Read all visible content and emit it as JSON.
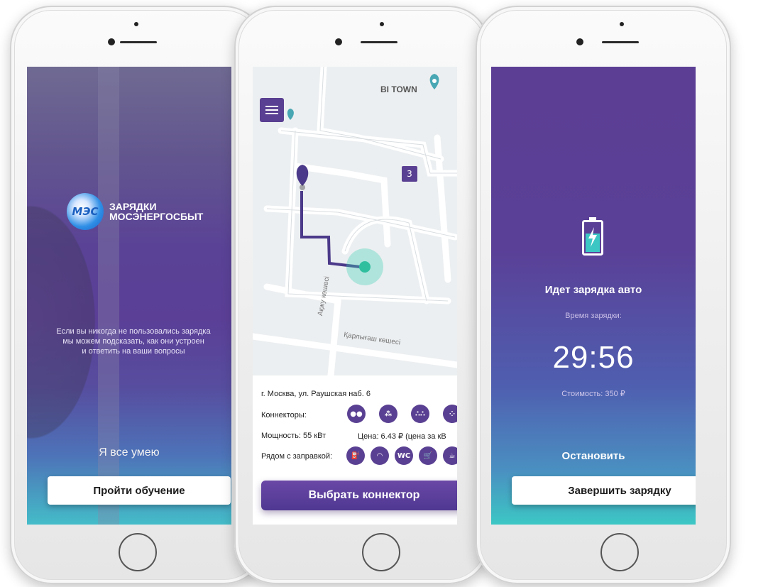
{
  "screen1": {
    "brand_line1": "ЗАРЯДКИ",
    "brand_line2": "МОСЭНЕРГОСБЫТ",
    "logo_text": "МЭС",
    "intro_line1": "Если вы никогда не пользовались зарядка",
    "intro_line2": "мы можем подсказать, как они устроен",
    "intro_line3": "и ответить на ваши вопросы",
    "skip_label": "Я все умею",
    "tutorial_button": "Пройти обучение"
  },
  "screen2": {
    "place_label": "BI TOWN",
    "cluster_count": "3",
    "street_1": "Ақжу көшесі",
    "street_2": "Қарлығаш көшесі",
    "address": "г. Москва, ул. Раушская наб. 6",
    "connectors_label": "Коннекторы:",
    "power": "Мощность: 55 кВт",
    "price": "Цена: 6.43 ₽ (цена за кВ",
    "nearby_label": "Рядом с заправкой:",
    "nearby_icons": [
      "fuel-icon",
      "wifi-icon",
      "wc-icon",
      "cart-icon",
      "coffee-icon"
    ],
    "amenity_wc": "WC",
    "choose_button": "Выбрать коннектор"
  },
  "screen3": {
    "status": "Идет зарядка авто",
    "time_label": "Время зарядки:",
    "timer": "29:56",
    "cost": "Стоимость: 350 ₽",
    "stop_label": "Остановить",
    "finish_button": "Завершить зарядку"
  },
  "colors": {
    "brand_purple": "#5a4092",
    "teal_accent": "#3cc7c4"
  }
}
